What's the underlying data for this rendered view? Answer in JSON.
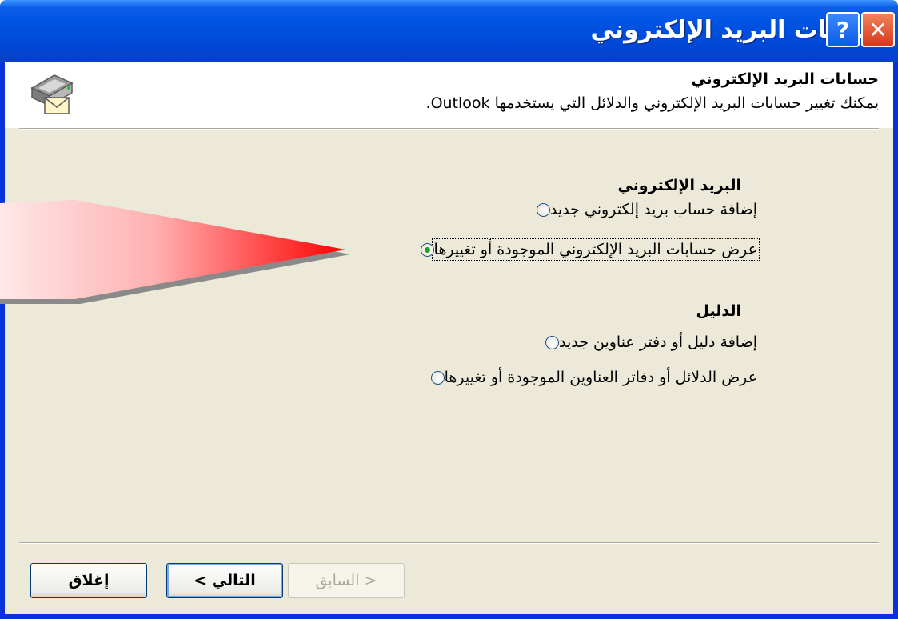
{
  "window": {
    "title": "حسابات البريد الإلكتروني",
    "help_glyph": "?",
    "close_glyph": "✕"
  },
  "header": {
    "title": "حسابات البريد الإلكتروني",
    "subtitle": "يمكنك تغيير حسابات البريد الإلكتروني والدلائل التي يستخدمها Outlook.",
    "icon": "mail-accounts-icon"
  },
  "email_group": {
    "title": "البريد الإلكتروني",
    "options": [
      {
        "label": "إضافة حساب بريد إلكتروني جديد",
        "checked": false
      },
      {
        "label": "عرض حسابات البريد الإلكتروني الموجودة أو تغييرها",
        "checked": true
      }
    ]
  },
  "directory_group": {
    "title": "الدليل",
    "options": [
      {
        "label": "إضافة دليل أو دفتر عناوين جديد",
        "checked": false
      },
      {
        "label": "عرض الدلائل أو دفاتر العناوين الموجودة أو تغييرها",
        "checked": false
      }
    ]
  },
  "buttons": {
    "back": "< السابق",
    "next": "التالي >",
    "close": "إغلاق"
  },
  "colors": {
    "titlebar": "#0054e3",
    "dialog": "#ece9d8",
    "callout_arrow": "#ff0000"
  }
}
